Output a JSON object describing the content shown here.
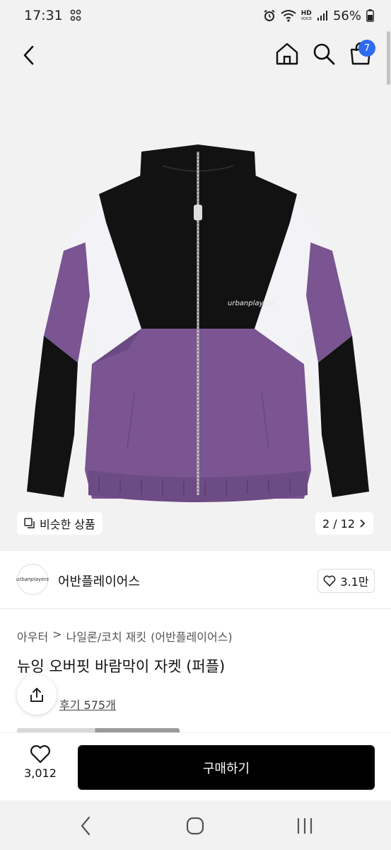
{
  "status_bar": {
    "time": "17:31",
    "network_label_top": "HD",
    "network_label_bottom": "VOICE",
    "battery": "56%"
  },
  "header": {
    "cart_count": "7",
    "icons": [
      "back-icon",
      "home-icon",
      "search-icon",
      "cart-icon"
    ]
  },
  "gallery": {
    "similar_label": "비슷한 상품",
    "page_indicator": "2 / 12",
    "jacket_logo_text": "urbanplayers"
  },
  "brand": {
    "name": "어반플레이어스",
    "logo_text": "urbanplayers",
    "like_count": "3.1만"
  },
  "product": {
    "breadcrumb": [
      "아우터",
      "나일론/코치 재킷",
      "(어반플레이어스)"
    ],
    "title": "뉴잉 오버핏 바람막이 자켓 (퍼플)",
    "review_label": "후기 575개"
  },
  "bottom_bar": {
    "wish_count": "3,012",
    "buy_label": "구매하기"
  },
  "colors": {
    "accent_badge": "#2e6bf0",
    "jacket_black": "#121212",
    "jacket_purple": "#7a5591",
    "jacket_white": "#f3f2f6",
    "buy_button": "#000000"
  }
}
